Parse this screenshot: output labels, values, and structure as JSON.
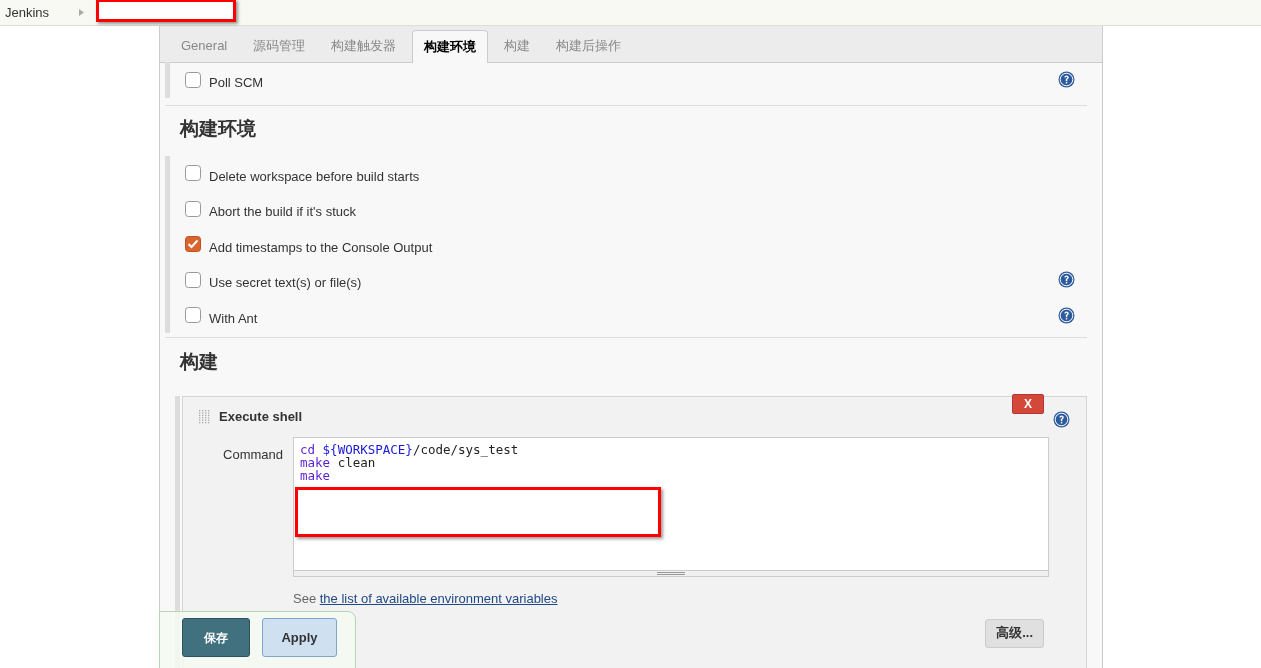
{
  "breadcrumb": {
    "root": "Jenkins",
    "redacted": true
  },
  "tabs": [
    {
      "label": "General",
      "selected": false
    },
    {
      "label": "源码管理",
      "selected": false
    },
    {
      "label": "构建触发器",
      "selected": false
    },
    {
      "label": "构建环境",
      "selected": true
    },
    {
      "label": "构建",
      "selected": false
    },
    {
      "label": "构建后操作",
      "selected": false
    }
  ],
  "trigger_options": [
    {
      "label": "Poll SCM",
      "checked": false,
      "help": true
    }
  ],
  "sections": [
    {
      "title": "构建环境",
      "options": [
        {
          "label": "Delete workspace before build starts",
          "checked": false,
          "help": false
        },
        {
          "label": "Abort the build if it's stuck",
          "checked": false,
          "help": false
        },
        {
          "label": "Add timestamps to the Console Output",
          "checked": true,
          "help": false
        },
        {
          "label": "Use secret text(s) or file(s)",
          "checked": false,
          "help": true
        },
        {
          "label": "With Ant",
          "checked": false,
          "help": true
        }
      ]
    },
    {
      "title": "构建"
    }
  ],
  "build_step": {
    "title": "Execute shell",
    "delete": "X",
    "field_label": "Command",
    "code": [
      [
        {
          "kind": "keyword",
          "text": "cd "
        },
        {
          "kind": "variable",
          "text": "${WORKSPACE}"
        },
        {
          "kind": "plain",
          "text": "/code/sys_test"
        }
      ],
      [
        {
          "kind": "keyword",
          "text": "make"
        },
        {
          "kind": "plain",
          "text": " clean"
        }
      ],
      [
        {
          "kind": "keyword",
          "text": "make"
        }
      ]
    ],
    "redacted": true,
    "hint": "See ",
    "hint_link": "the list of available environment variables",
    "advanced": "高级..."
  },
  "footer": {
    "save": "保存",
    "apply": "Apply"
  }
}
